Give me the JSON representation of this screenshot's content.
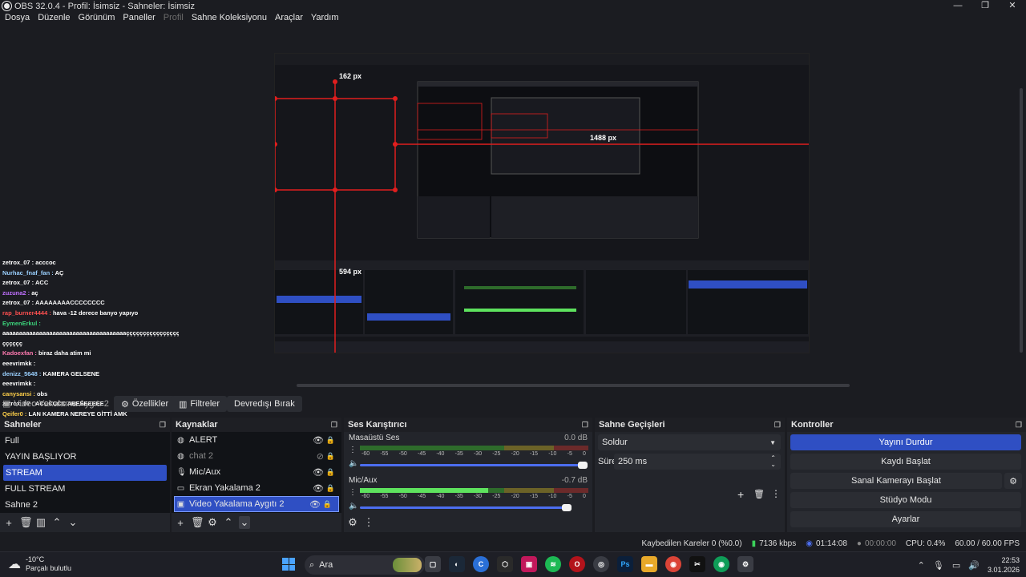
{
  "window": {
    "title": "OBS 32.0.4 - Profil: İsimsiz - Sahneler: İsimsiz",
    "controls": [
      "—",
      "❐",
      "✕"
    ]
  },
  "menu": {
    "items": [
      "Dosya",
      "Düzenle",
      "Görünüm",
      "Paneller",
      "Profil",
      "Sahne Koleksiyonu",
      "Araçlar",
      "Yardım"
    ]
  },
  "preview": {
    "measure_top": "162 px",
    "measure_right": "1488 px",
    "measure_bottom": "594 px"
  },
  "chat": [
    {
      "user": "zetrox_07",
      "msg": "acccoc",
      "color": "#ffffff"
    },
    {
      "user": "Nurhac_fnaf_fan",
      "msg": "AÇ",
      "color": "#9ad0ff"
    },
    {
      "user": "zetrox_07",
      "msg": "ACC",
      "color": "#ffffff"
    },
    {
      "user": "zuzuna2",
      "msg": "aç",
      "color": "#c070ff"
    },
    {
      "user": "zetrox_07",
      "msg": "AAAAAAAACCCCCCCC",
      "color": "#ffffff"
    },
    {
      "user": "rap_burner4444",
      "msg": "hava -12 derece banyo yapıyo",
      "color": "#ff5050"
    },
    {
      "user": "EymenErkul",
      "msg": "",
      "color": "#3bd17a"
    },
    {
      "user": "",
      "msg": "aaaaaaaaaaaaaaaaaaaaaaaaaaaaaaaaaaaaaçççççççççççççççç",
      "color": "#ffffff"
    },
    {
      "user": "",
      "msg": "çççççç",
      "color": "#ffffff"
    },
    {
      "user": "Kadoexfan",
      "msg": "biraz daha atim mi",
      "color": "#ff7ab0"
    },
    {
      "user": "eeevrimkk",
      "msg": "",
      "color": "#ffffff"
    },
    {
      "user": "denizz_5648",
      "msg": "KAMERA GELSENE",
      "color": "#9ad0ff"
    },
    {
      "user": "eeevrimkk",
      "msg": "",
      "color": "#ffffff"
    },
    {
      "user": "canysansi",
      "msg": "obs",
      "color": "#ffd04a"
    },
    {
      "user": "zetrox_07",
      "msg": "ACCCCCC ABEEEEEEE",
      "color": "#ffffff"
    },
    {
      "user": "Qeifer0",
      "msg": "LAN KAMERA NEREYE GİTTİ AMK",
      "color": "#ffd04a"
    }
  ],
  "source_toolbar": {
    "selected_source": "Video Yakalama Aygıtı 2",
    "properties": "Özellikler",
    "filters": "Filtreler",
    "deactivate": "Devredışı Bırak"
  },
  "scenes": {
    "title": "Sahneler",
    "items": [
      "Full",
      "YAYIN BAŞLIYOR",
      "STREAM",
      "FULL STREAM",
      "Sahne 2"
    ],
    "active_index": 2
  },
  "sources": {
    "title": "Kaynaklar",
    "items": [
      {
        "label": "ALERT",
        "icon": "globe-icon"
      },
      {
        "label": "chat 2",
        "icon": "globe-icon"
      },
      {
        "label": "Mic/Aux",
        "icon": "mic-icon"
      },
      {
        "label": "Ekran Yakalama 2",
        "icon": "monitor-icon"
      },
      {
        "label": "Video Yakalama Aygıtı 2",
        "icon": "camera-icon"
      }
    ]
  },
  "mixer": {
    "title": "Ses Karıştırıcı",
    "scale": [
      "-60",
      "-55",
      "-50",
      "-45",
      "-40",
      "-35",
      "-30",
      "-25",
      "-20",
      "-15",
      "-10",
      "-5",
      "0"
    ],
    "channels": [
      {
        "name": "Masaüstü Ses",
        "db": "0.0 dB",
        "level": 0,
        "volume": 1.0
      },
      {
        "name": "Mic/Aux",
        "db": "-0.7 dB",
        "level": 0.56,
        "volume": 0.93
      }
    ]
  },
  "transitions": {
    "title": "Sahne Geçişleri",
    "selected": "Soldur",
    "duration_label": "Süre",
    "duration_value": "250 ms"
  },
  "controls": {
    "title": "Kontroller",
    "stop_stream": "Yayını Durdur",
    "start_record": "Kaydı Başlat",
    "virtual_cam": "Sanal Kamerayı Başlat",
    "studio_mode": "Stüdyo Modu",
    "settings": "Ayarlar"
  },
  "status": {
    "dropped": "Kaybedilen Kareler 0 (%0.0)",
    "bitrate": "7136 kbps",
    "stream_time": "01:14:08",
    "record_time": "00:00:00",
    "cpu": "CPU: 0.4%",
    "fps": "60.00 / 60.00 FPS"
  },
  "taskbar": {
    "temperature": "-10°C",
    "weather": "Parçalı bulutlu",
    "search": "Ara",
    "time": "22:53",
    "date": "3.01.2026",
    "apps": [
      {
        "name": "Ps",
        "color": "#0b1f3a"
      },
      {
        "name": "",
        "color": "#e8a92a"
      }
    ]
  }
}
